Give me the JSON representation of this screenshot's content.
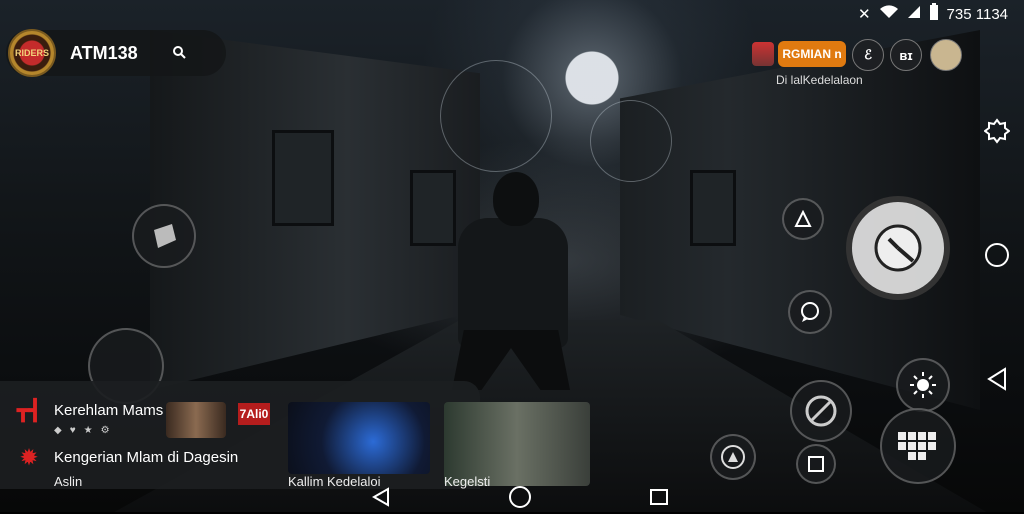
{
  "status_bar": {
    "time": "735 1134"
  },
  "profile": {
    "name": "ATM138",
    "avatar_text": "RIDERS"
  },
  "top_right": {
    "rank_label": "RGMIAN n",
    "button_1": "ℰ",
    "button_2": "ʙɪ",
    "subtitle": "Di lalKedelalaon"
  },
  "panel": {
    "channel_1": "Kerehlam Mams",
    "channel_2": "Kengerian Mlam di Dagesin",
    "channel_2_sub": "Aslin",
    "badge": "7Ali0",
    "card_1_title": "Kallim Kedelaloi",
    "card_2_title": "Kegelsti"
  },
  "icons": {
    "status": [
      "vibrate-icon",
      "wifi-icon",
      "signal-icon",
      "battery-icon"
    ],
    "sysnav": [
      "settings-icon",
      "home-circle-icon",
      "back-triangle-icon"
    ]
  }
}
